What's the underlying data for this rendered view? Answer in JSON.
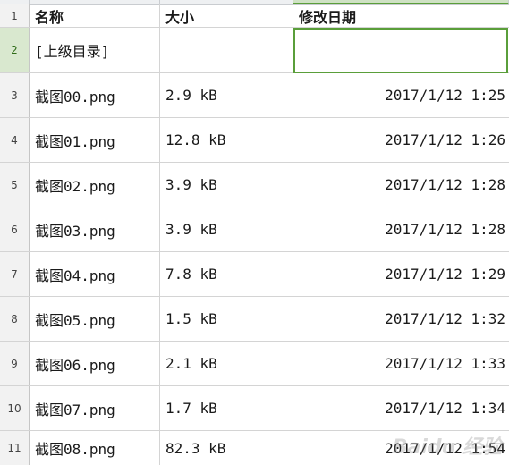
{
  "headers": {
    "name": "名称",
    "size": "大小",
    "modified": "修改日期"
  },
  "row_numbers": [
    "1",
    "2",
    "3",
    "4",
    "5",
    "6",
    "7",
    "8",
    "9",
    "10",
    "11"
  ],
  "parent_dir": "[上级目录]",
  "files": [
    {
      "name": "截图00.png",
      "size": "2.9 kB",
      "modified": "2017/1/12 1:25"
    },
    {
      "name": "截图01.png",
      "size": "12.8 kB",
      "modified": "2017/1/12 1:26"
    },
    {
      "name": "截图02.png",
      "size": "3.9 kB",
      "modified": "2017/1/12 1:28"
    },
    {
      "name": "截图03.png",
      "size": "3.9 kB",
      "modified": "2017/1/12 1:28"
    },
    {
      "name": "截图04.png",
      "size": "7.8 kB",
      "modified": "2017/1/12 1:29"
    },
    {
      "name": "截图05.png",
      "size": "1.5 kB",
      "modified": "2017/1/12 1:32"
    },
    {
      "name": "截图06.png",
      "size": "2.1 kB",
      "modified": "2017/1/12 1:33"
    },
    {
      "name": "截图07.png",
      "size": "1.7 kB",
      "modified": "2017/1/12 1:34"
    },
    {
      "name": "截图08.png",
      "size": "82.3 kB",
      "modified": "2017/1/12 1:54"
    }
  ],
  "watermark": "Baidu 经验",
  "colors": {
    "selection": "#5a9e3a",
    "row_header_bg": "#f2f2f2",
    "gridline": "#d4d4d4"
  }
}
